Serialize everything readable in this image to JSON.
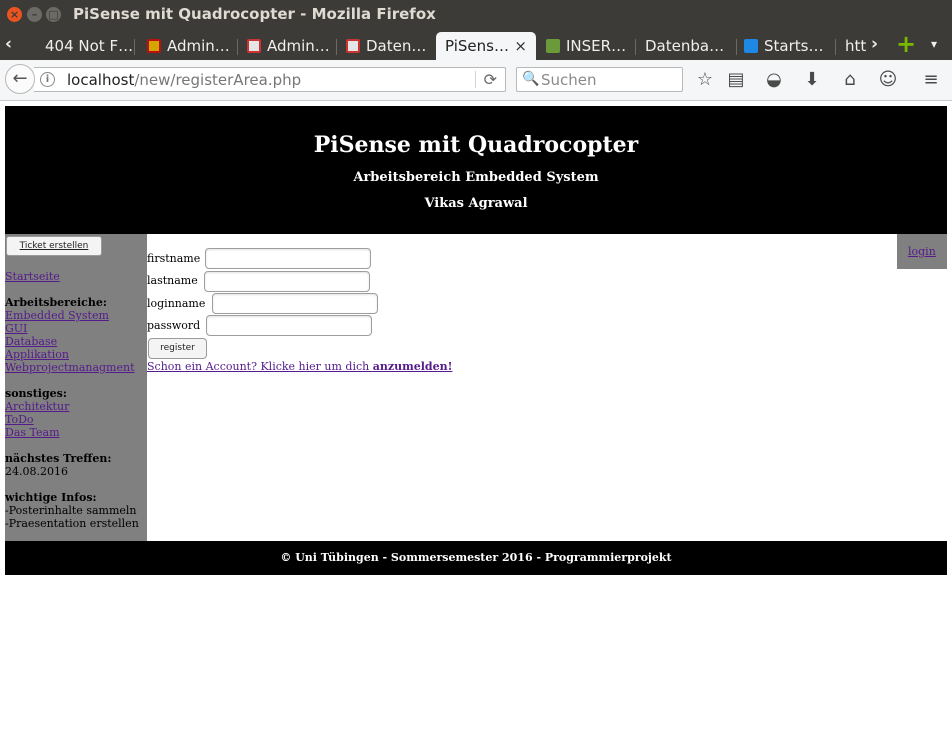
{
  "window": {
    "title": "PiSense mit Quadrocopter - Mozilla Firefox",
    "close_glyph": "×",
    "min_glyph": "–",
    "max_glyph": "□"
  },
  "tabs": [
    {
      "label": "404 Not F…"
    },
    {
      "label": "Admin…"
    },
    {
      "label": "Admin…"
    },
    {
      "label": "Daten…"
    },
    {
      "label": "PiSens…",
      "active": true,
      "close": "×"
    },
    {
      "label": "INSER…"
    },
    {
      "label": "Datenba…"
    },
    {
      "label": "Starts…"
    },
    {
      "label": "htt"
    }
  ],
  "tabstrip": {
    "scroll_left": "‹",
    "scroll_right": "›",
    "new_tab": "+",
    "list_all": "▾"
  },
  "navbar": {
    "back_glyph": "←",
    "info_glyph": "i",
    "url_host": "localhost",
    "url_path": "/new/registerArea.php",
    "reload_glyph": "⟳",
    "search_glyph": "🔍",
    "search_placeholder": "Suchen",
    "icons": {
      "bookmark": "☆",
      "reader": "▤",
      "pocket": "◒",
      "downloads": "⬇",
      "home": "⌂",
      "smiley": "☺",
      "menu": "≡"
    }
  },
  "header": {
    "title": "PiSense mit Quadrocopter",
    "subtitle": "Arbeitsbereich Embedded System",
    "author": "Vikas Agrawal"
  },
  "sidebar": {
    "ticket_button": "Ticket erstellen",
    "startseite": "Startseite",
    "areas_heading": "Arbeitsbereiche:",
    "areas": [
      "Embedded System",
      "GUI",
      "Database",
      "Applikation",
      "Webprojectmanagment"
    ],
    "misc_heading": "sonstiges:",
    "misc": [
      "Architektur",
      "ToDo",
      "Das Team"
    ],
    "meeting_heading": "nächstes Treffen:",
    "meeting_date": "24.08.2016",
    "info_heading": "wichtige Infos:",
    "infos": [
      "-Posterinhalte sammeln",
      "-Praesentation erstellen"
    ]
  },
  "form": {
    "firstname_label": "firstname",
    "lastname_label": "lastname",
    "loginname_label": "loginname",
    "password_label": "password",
    "firstname_value": "",
    "lastname_value": "",
    "loginname_value": "",
    "password_value": "",
    "register_button": "register",
    "account_text": "Schon ein Account? Klicke hier um dich ",
    "account_link": "anzumelden!"
  },
  "right_panel": {
    "login": "login"
  },
  "footer": {
    "text": "© Uni Tübingen - Sommersemester 2016 - Programmierprojekt"
  },
  "colors": {
    "titlebar": "#3c3b37",
    "close_button": "#e95420",
    "page_black": "#000000",
    "sidebar_gray": "#808080",
    "visited_link": "#551a8b"
  }
}
